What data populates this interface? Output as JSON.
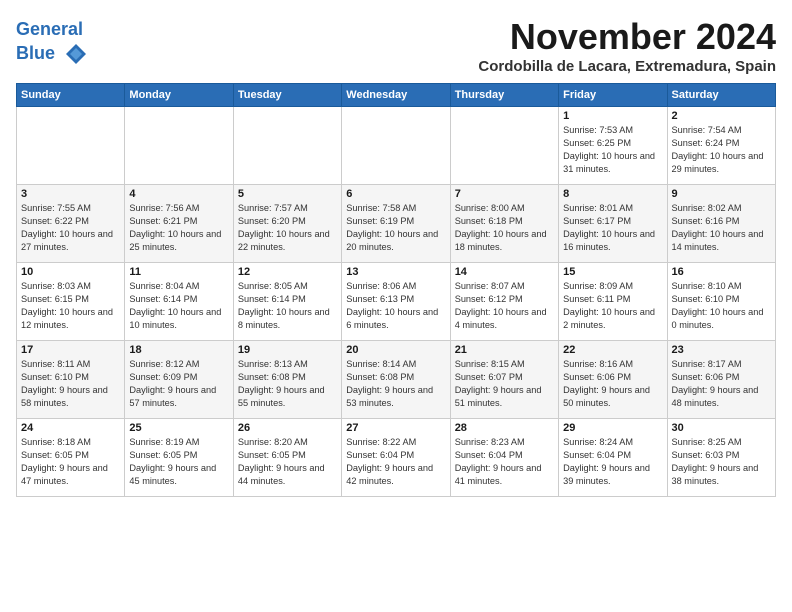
{
  "logo": {
    "line1": "General",
    "line2": "Blue"
  },
  "title": "November 2024",
  "location": "Cordobilla de Lacara, Extremadura, Spain",
  "days_of_week": [
    "Sunday",
    "Monday",
    "Tuesday",
    "Wednesday",
    "Thursday",
    "Friday",
    "Saturday"
  ],
  "weeks": [
    [
      {
        "day": "",
        "info": ""
      },
      {
        "day": "",
        "info": ""
      },
      {
        "day": "",
        "info": ""
      },
      {
        "day": "",
        "info": ""
      },
      {
        "day": "",
        "info": ""
      },
      {
        "day": "1",
        "info": "Sunrise: 7:53 AM\nSunset: 6:25 PM\nDaylight: 10 hours and 31 minutes."
      },
      {
        "day": "2",
        "info": "Sunrise: 7:54 AM\nSunset: 6:24 PM\nDaylight: 10 hours and 29 minutes."
      }
    ],
    [
      {
        "day": "3",
        "info": "Sunrise: 7:55 AM\nSunset: 6:22 PM\nDaylight: 10 hours and 27 minutes."
      },
      {
        "day": "4",
        "info": "Sunrise: 7:56 AM\nSunset: 6:21 PM\nDaylight: 10 hours and 25 minutes."
      },
      {
        "day": "5",
        "info": "Sunrise: 7:57 AM\nSunset: 6:20 PM\nDaylight: 10 hours and 22 minutes."
      },
      {
        "day": "6",
        "info": "Sunrise: 7:58 AM\nSunset: 6:19 PM\nDaylight: 10 hours and 20 minutes."
      },
      {
        "day": "7",
        "info": "Sunrise: 8:00 AM\nSunset: 6:18 PM\nDaylight: 10 hours and 18 minutes."
      },
      {
        "day": "8",
        "info": "Sunrise: 8:01 AM\nSunset: 6:17 PM\nDaylight: 10 hours and 16 minutes."
      },
      {
        "day": "9",
        "info": "Sunrise: 8:02 AM\nSunset: 6:16 PM\nDaylight: 10 hours and 14 minutes."
      }
    ],
    [
      {
        "day": "10",
        "info": "Sunrise: 8:03 AM\nSunset: 6:15 PM\nDaylight: 10 hours and 12 minutes."
      },
      {
        "day": "11",
        "info": "Sunrise: 8:04 AM\nSunset: 6:14 PM\nDaylight: 10 hours and 10 minutes."
      },
      {
        "day": "12",
        "info": "Sunrise: 8:05 AM\nSunset: 6:14 PM\nDaylight: 10 hours and 8 minutes."
      },
      {
        "day": "13",
        "info": "Sunrise: 8:06 AM\nSunset: 6:13 PM\nDaylight: 10 hours and 6 minutes."
      },
      {
        "day": "14",
        "info": "Sunrise: 8:07 AM\nSunset: 6:12 PM\nDaylight: 10 hours and 4 minutes."
      },
      {
        "day": "15",
        "info": "Sunrise: 8:09 AM\nSunset: 6:11 PM\nDaylight: 10 hours and 2 minutes."
      },
      {
        "day": "16",
        "info": "Sunrise: 8:10 AM\nSunset: 6:10 PM\nDaylight: 10 hours and 0 minutes."
      }
    ],
    [
      {
        "day": "17",
        "info": "Sunrise: 8:11 AM\nSunset: 6:10 PM\nDaylight: 9 hours and 58 minutes."
      },
      {
        "day": "18",
        "info": "Sunrise: 8:12 AM\nSunset: 6:09 PM\nDaylight: 9 hours and 57 minutes."
      },
      {
        "day": "19",
        "info": "Sunrise: 8:13 AM\nSunset: 6:08 PM\nDaylight: 9 hours and 55 minutes."
      },
      {
        "day": "20",
        "info": "Sunrise: 8:14 AM\nSunset: 6:08 PM\nDaylight: 9 hours and 53 minutes."
      },
      {
        "day": "21",
        "info": "Sunrise: 8:15 AM\nSunset: 6:07 PM\nDaylight: 9 hours and 51 minutes."
      },
      {
        "day": "22",
        "info": "Sunrise: 8:16 AM\nSunset: 6:06 PM\nDaylight: 9 hours and 50 minutes."
      },
      {
        "day": "23",
        "info": "Sunrise: 8:17 AM\nSunset: 6:06 PM\nDaylight: 9 hours and 48 minutes."
      }
    ],
    [
      {
        "day": "24",
        "info": "Sunrise: 8:18 AM\nSunset: 6:05 PM\nDaylight: 9 hours and 47 minutes."
      },
      {
        "day": "25",
        "info": "Sunrise: 8:19 AM\nSunset: 6:05 PM\nDaylight: 9 hours and 45 minutes."
      },
      {
        "day": "26",
        "info": "Sunrise: 8:20 AM\nSunset: 6:05 PM\nDaylight: 9 hours and 44 minutes."
      },
      {
        "day": "27",
        "info": "Sunrise: 8:22 AM\nSunset: 6:04 PM\nDaylight: 9 hours and 42 minutes."
      },
      {
        "day": "28",
        "info": "Sunrise: 8:23 AM\nSunset: 6:04 PM\nDaylight: 9 hours and 41 minutes."
      },
      {
        "day": "29",
        "info": "Sunrise: 8:24 AM\nSunset: 6:04 PM\nDaylight: 9 hours and 39 minutes."
      },
      {
        "day": "30",
        "info": "Sunrise: 8:25 AM\nSunset: 6:03 PM\nDaylight: 9 hours and 38 minutes."
      }
    ]
  ]
}
